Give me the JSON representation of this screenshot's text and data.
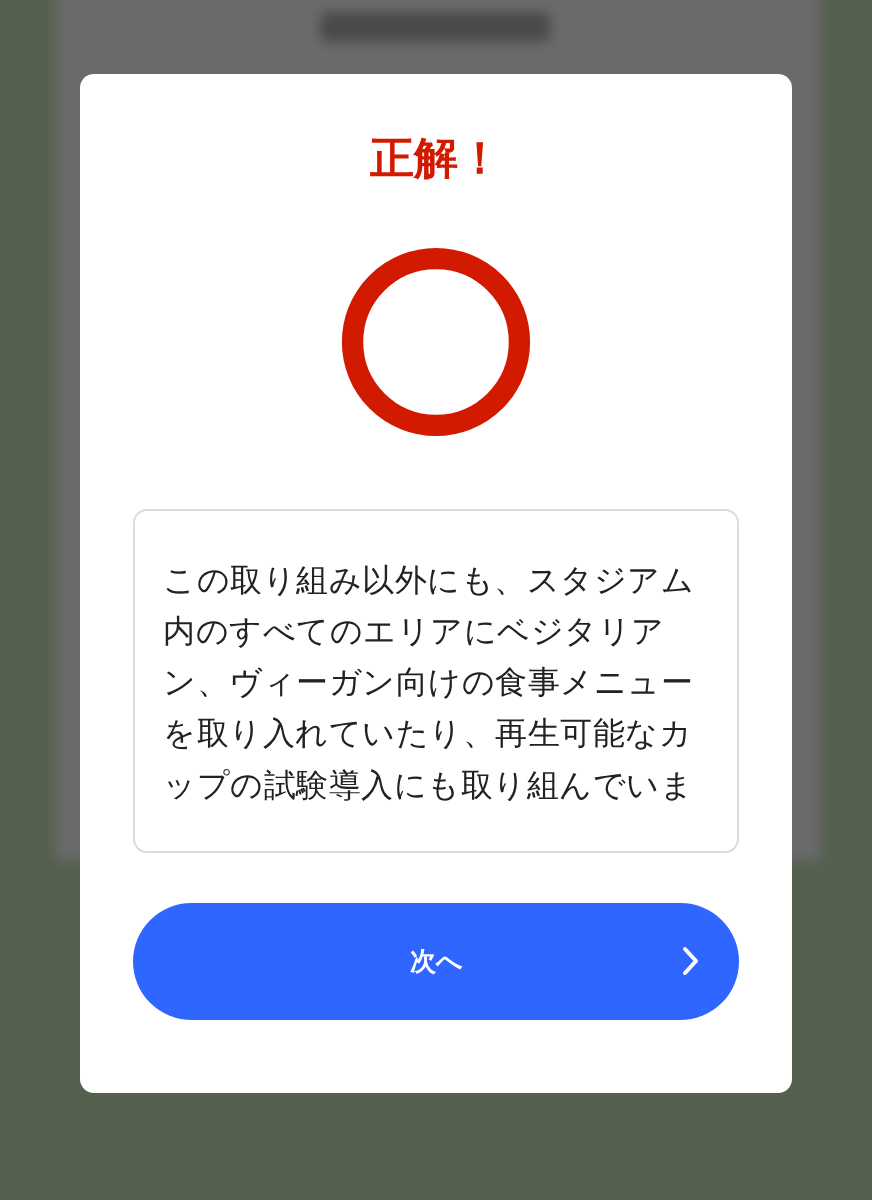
{
  "dialog": {
    "title": "正解！",
    "correct": true,
    "explanation": "この取り組み以外にも、スタジアム内のすべてのエリアにベジタリアン、ヴィーガン向けの食事メニューを取り入れていたり、再生可能なカップの試験導入にも取り組んでいま",
    "next_button": {
      "label": "次へ"
    }
  }
}
